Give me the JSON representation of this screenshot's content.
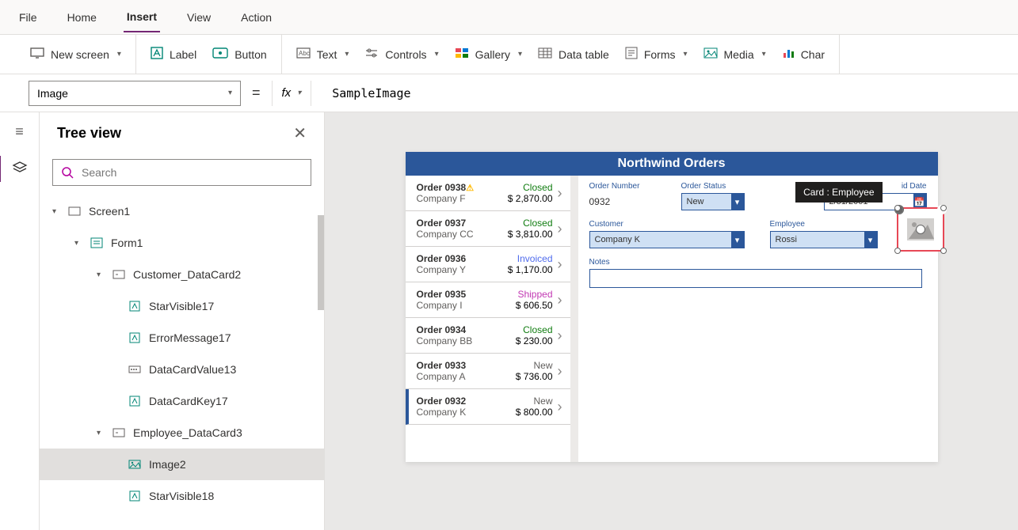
{
  "menubar": {
    "file": "File",
    "home": "Home",
    "insert": "Insert",
    "view": "View",
    "action": "Action"
  },
  "ribbon": {
    "new_screen": "New screen",
    "label": "Label",
    "button": "Button",
    "text": "Text",
    "controls": "Controls",
    "gallery": "Gallery",
    "data_table": "Data table",
    "forms": "Forms",
    "media": "Media",
    "chart": "Char"
  },
  "formula": {
    "property": "Image",
    "value": "SampleImage"
  },
  "tree": {
    "title": "Tree view",
    "search_placeholder": "Search",
    "nodes": {
      "screen1": "Screen1",
      "form1": "Form1",
      "customer_dc": "Customer_DataCard2",
      "starvisible17": "StarVisible17",
      "errormsg17": "ErrorMessage17",
      "dcvalue13": "DataCardValue13",
      "dckey17": "DataCardKey17",
      "employee_dc": "Employee_DataCard3",
      "image2": "Image2",
      "starvisible18": "StarVisible18"
    }
  },
  "app": {
    "title": "Northwind Orders",
    "orders": [
      {
        "num": "Order 0938",
        "warn": true,
        "company": "Company F",
        "status": "Closed",
        "status_cls": "ostat-closed",
        "amount": "$ 2,870.00"
      },
      {
        "num": "Order 0937",
        "company": "Company CC",
        "status": "Closed",
        "status_cls": "ostat-closed",
        "amount": "$ 3,810.00"
      },
      {
        "num": "Order 0936",
        "company": "Company Y",
        "status": "Invoiced",
        "status_cls": "ostat-invoiced",
        "amount": "$ 1,170.00"
      },
      {
        "num": "Order 0935",
        "company": "Company I",
        "status": "Shipped",
        "status_cls": "ostat-shipped",
        "amount": "$ 606.50"
      },
      {
        "num": "Order 0934",
        "company": "Company BB",
        "status": "Closed",
        "status_cls": "ostat-closed",
        "amount": "$ 230.00"
      },
      {
        "num": "Order 0933",
        "company": "Company A",
        "status": "New",
        "status_cls": "ostat-new",
        "amount": "$ 736.00"
      },
      {
        "num": "Order 0932",
        "company": "Company K",
        "status": "New",
        "status_cls": "ostat-new",
        "amount": "$ 800.00"
      }
    ],
    "detail": {
      "order_number_label": "Order Number",
      "order_number": "0932",
      "order_status_label": "Order Status",
      "order_status": "New",
      "paid_date_label": "id Date",
      "paid_date": "2/31/2001",
      "customer_label": "Customer",
      "customer": "Company K",
      "employee_label": "Employee",
      "employee": "Rossi",
      "notes_label": "Notes",
      "tooltip": "Card : Employee"
    }
  }
}
